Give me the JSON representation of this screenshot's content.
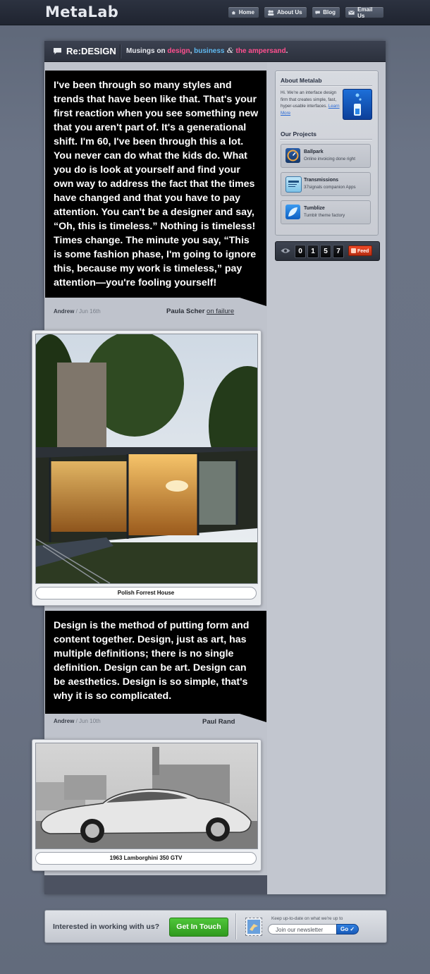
{
  "app": {
    "logo": "MetaLab"
  },
  "nav": [
    {
      "label": "Home",
      "icon": "home-icon"
    },
    {
      "label": "About Us",
      "icon": "people-icon"
    },
    {
      "label": "Blog",
      "icon": "speech-bubble-icon"
    },
    {
      "label": "Email Us",
      "icon": "envelope-icon"
    }
  ],
  "header": {
    "title": "Re:DESIGN",
    "tagline": {
      "prefix": "Musings on ",
      "design": "design",
      "sep1": ", ",
      "business": "business",
      "amp": " & ",
      "ampersand": "the ampersand",
      "suffix": "."
    }
  },
  "posts": [
    {
      "quote": "I've been through so many styles and trends that have been like that. That's your first reaction when you see something new that you aren't part of. It's a generational shift. I'm 60, I've been through this a lot. You never can do what the kids do. What you do is look at yourself and find your own way to address the fact that the times have changed and that you have to pay attention. You can't be a designer and say, “Oh, this is timeless.” Nothing is timeless! Times change. The minute you say, “This is some fashion phase, I'm going to ignore this, because my work is timeless,” pay attention—you're fooling yourself!",
      "author": "Andrew",
      "date": " / Jun 16th",
      "attribution": "Paula Scher",
      "attribution_link": "on failure"
    },
    {
      "quote": "Design is the method of putting form and content together. Design, just as art, has multiple definitions; there is no single definition. Design can be art. Design can be aesthetics. Design is so simple, that's why it is so complicated.",
      "author": "Andrew",
      "date": " / Jun 10th",
      "attribution": "Paul Rand"
    }
  ],
  "photos": [
    {
      "caption": "Polish Forrest House"
    },
    {
      "caption": "1963 Lamborghini 350 GTV"
    }
  ],
  "sidebar": {
    "about_title": "About Metalab",
    "about_text": "Hi. We're an interface design firm that creates simple, fast, hyper-usable interfaces. ",
    "about_link": "Learn More",
    "projects_title": "Our Projects",
    "projects": [
      {
        "name": "Ballpark",
        "desc": "Online invoicing done right",
        "icon": "gauge-icon"
      },
      {
        "name": "Transmissions",
        "desc": "37signals companion Apps",
        "icon": "logbook-icon"
      },
      {
        "name": "Tumblize",
        "desc": "Tumblr theme factory",
        "icon": "leaf-icon"
      }
    ],
    "counter": [
      "0",
      "1",
      "5",
      "7"
    ],
    "feed_label": "Feed"
  },
  "footer": {
    "question": "Interested in working with us?",
    "cta": "Get In Touch",
    "newsletter_note": "Keep up-to-date on what we're up to",
    "newsletter_placeholder": "Join our newsletter",
    "go": "Go ✓"
  },
  "colors": {
    "accent_pink": "#ff4f8e",
    "accent_blue": "#5fb9f0",
    "cta_green": "#3bb028",
    "feed_orange": "#e0441f"
  }
}
